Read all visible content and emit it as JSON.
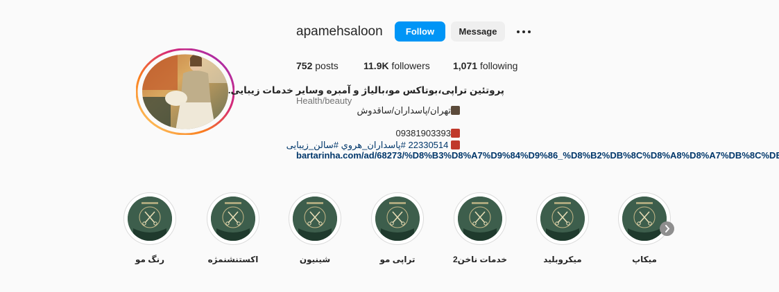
{
  "profile": {
    "username": "apamehsaloon",
    "follow_label": "Follow",
    "message_label": "Message",
    "more_icon": "more-horizontal-icon",
    "stats": {
      "posts_count": "752",
      "posts_label": "posts",
      "followers_count": "11.9K",
      "followers_label": "followers",
      "following_count": "1,071",
      "following_label": "following"
    },
    "bio": {
      "name": "پروتئین تراپی،بوتاکس مو،بالیاژ و آمبره وسایر خدمات زیبایی.",
      "category": "Health/beauty",
      "address": "تهران/پاسداران/ساقدوش",
      "address_icon": "signpost-icon",
      "phone1": "09381903393",
      "phone2_text": "22330514 #پاسداران_هروي #سالن_زيبايى",
      "phone_icon": "telephone-icon",
      "link": "bartarinha.com/ad/68273/%D8%B3%D8%A7%D9%84%D9%86_%D8%B2%DB%8C%D8%A8%D8%A7%DB%8C%DB%8C_%D8"
    }
  },
  "highlights": [
    {
      "label": "رنگ مو"
    },
    {
      "label": "اکستنشنمژه"
    },
    {
      "label": "شینیون"
    },
    {
      "label": "تراپی مو"
    },
    {
      "label": "خدمات ناخن2"
    },
    {
      "label": "میکروبلید"
    },
    {
      "label": "میکاپ"
    }
  ],
  "colors": {
    "accent": "#0095f6",
    "link": "#00376b",
    "ring_gradient": [
      "#feda75",
      "#fa7e1e",
      "#d62976",
      "#962fbf"
    ],
    "highlight_cover": "#3d5e4c"
  }
}
